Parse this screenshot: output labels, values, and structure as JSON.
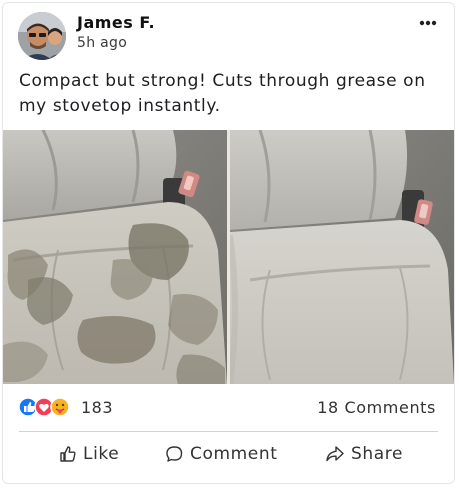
{
  "post": {
    "author": "James F.",
    "time": "5h ago",
    "text": "Compact but strong! Cuts through grease on my stovetop instantly."
  },
  "stats": {
    "reaction_icons": [
      "like-icon",
      "love-icon",
      "care-icon"
    ],
    "reaction_count": "183",
    "comments": "18 Comments"
  },
  "actions": {
    "like": "Like",
    "comment": "Comment",
    "share": "Share"
  },
  "colors": {
    "like_blue": "#1877f2",
    "love_red": "#f33e58",
    "care_yellow": "#f7b125"
  }
}
